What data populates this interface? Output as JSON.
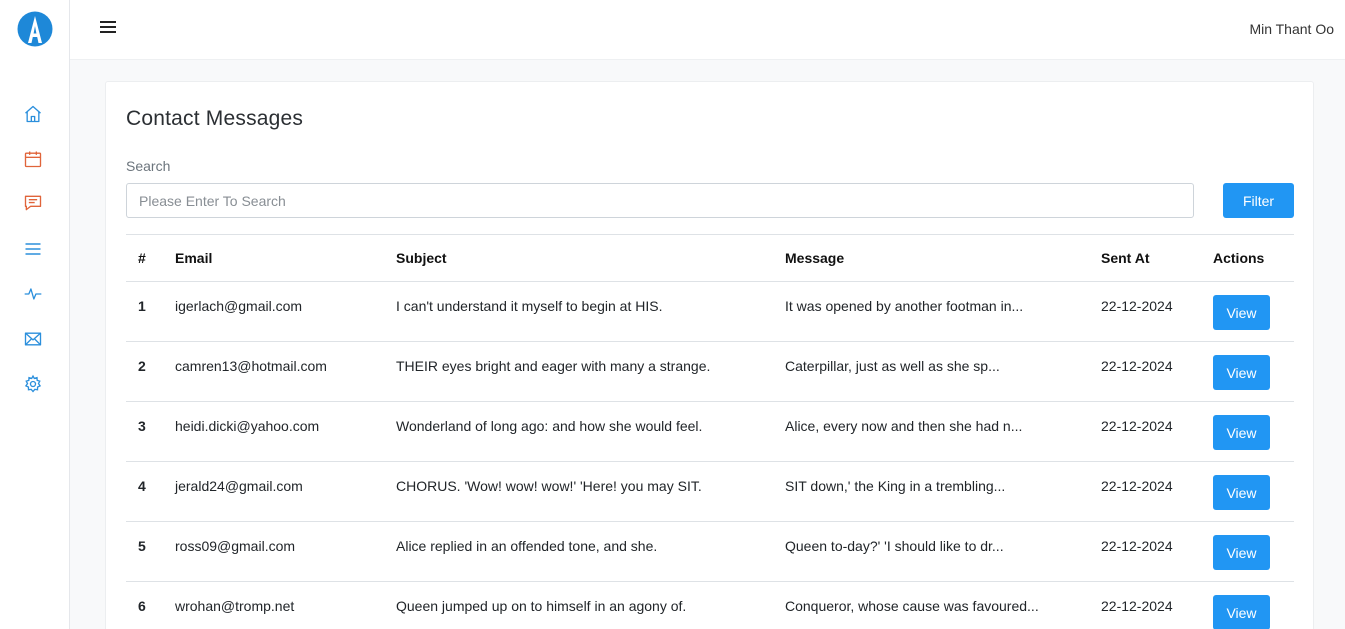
{
  "app": {
    "user_name": "Min Thant Oo",
    "accent_color": "#2196f3",
    "sidebar_icons": [
      "home-icon",
      "calendar-icon",
      "chat-icon",
      "menu-list-icon",
      "activity-icon",
      "mail-icon",
      "settings-icon"
    ]
  },
  "page": {
    "title": "Contact Messages",
    "search_label": "Search",
    "search_placeholder": "Please Enter To Search",
    "filter_label": "Filter"
  },
  "table": {
    "headers": [
      "#",
      "Email",
      "Subject",
      "Message",
      "Sent At",
      "Actions"
    ],
    "rows": [
      {
        "idx": "1",
        "email": "igerlach@gmail.com",
        "subject": "I can't understand it myself to begin at HIS.",
        "message": "It was opened by another footman in...",
        "sent_at": "22-12-2024",
        "action": "View"
      },
      {
        "idx": "2",
        "email": "camren13@hotmail.com",
        "subject": "THEIR eyes bright and eager with many a strange.",
        "message": "Caterpillar, just as well as she sp...",
        "sent_at": "22-12-2024",
        "action": "View"
      },
      {
        "idx": "3",
        "email": "heidi.dicki@yahoo.com",
        "subject": "Wonderland of long ago: and how she would feel.",
        "message": "Alice, every now and then she had n...",
        "sent_at": "22-12-2024",
        "action": "View"
      },
      {
        "idx": "4",
        "email": "jerald24@gmail.com",
        "subject": "CHORUS. 'Wow! wow! wow!' 'Here! you may SIT.",
        "message": "SIT down,' the King in a trembling...",
        "sent_at": "22-12-2024",
        "action": "View"
      },
      {
        "idx": "5",
        "email": "ross09@gmail.com",
        "subject": "Alice replied in an offended tone, and she.",
        "message": "Queen to-day?' 'I should like to dr...",
        "sent_at": "22-12-2024",
        "action": "View"
      },
      {
        "idx": "6",
        "email": "wrohan@tromp.net",
        "subject": "Queen jumped up on to himself in an agony of.",
        "message": "Conqueror, whose cause was favoured...",
        "sent_at": "22-12-2024",
        "action": "View"
      }
    ]
  }
}
